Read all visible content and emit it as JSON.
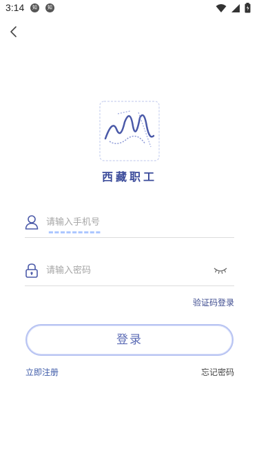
{
  "status_bar": {
    "time": "3:14",
    "app_icon_1": "知",
    "app_icon_2": "知"
  },
  "brand": {
    "name": "西藏职工",
    "accent_color": "#3d4b8f"
  },
  "form": {
    "phone_placeholder": "请输入手机号",
    "password_placeholder": "请输入密码",
    "sms_login_label": "验证码登录",
    "login_label": "登录",
    "register_label": "立即注册",
    "forgot_label": "忘记密码"
  },
  "icons": {
    "back": "chevron-left-icon",
    "user": "user-icon",
    "lock": "lock-icon",
    "eye": "eye-closed-icon"
  }
}
